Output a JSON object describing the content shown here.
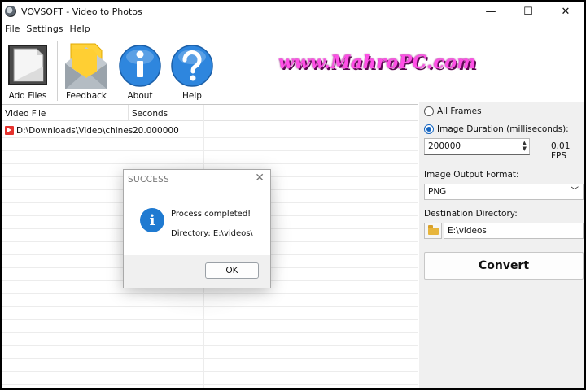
{
  "window": {
    "title": "VOVSOFT - Video to Photos",
    "minimize": "—",
    "maximize": "☐",
    "close": "✕"
  },
  "menu": [
    "File",
    "Settings",
    "Help"
  ],
  "toolbar": {
    "add_files": "Add Files",
    "feedback": "Feedback",
    "about": "About",
    "help": "Help"
  },
  "watermark": "www.MahroPC.com",
  "list": {
    "columns": [
      "Video File",
      "Seconds"
    ],
    "rows": [
      {
        "file": "D:\\Downloads\\Video\\chines...",
        "seconds": "20.000000"
      }
    ]
  },
  "panel": {
    "all_frames": "All Frames",
    "image_duration": "Image Duration (milliseconds):",
    "duration_value": "200000",
    "fps": "0.01 FPS",
    "output_format_label": "Image Output Format:",
    "output_format": "PNG",
    "destination_label": "Destination Directory:",
    "destination": "E:\\videos",
    "convert": "Convert"
  },
  "dialog": {
    "title": "SUCCESS",
    "message": "Process completed!",
    "directory": "Directory: E:\\videos\\",
    "ok": "OK"
  },
  "colors": {
    "accent": "#1f7ad1",
    "icon_blue": "#2e86de",
    "watermark": "#ff4fe6"
  }
}
